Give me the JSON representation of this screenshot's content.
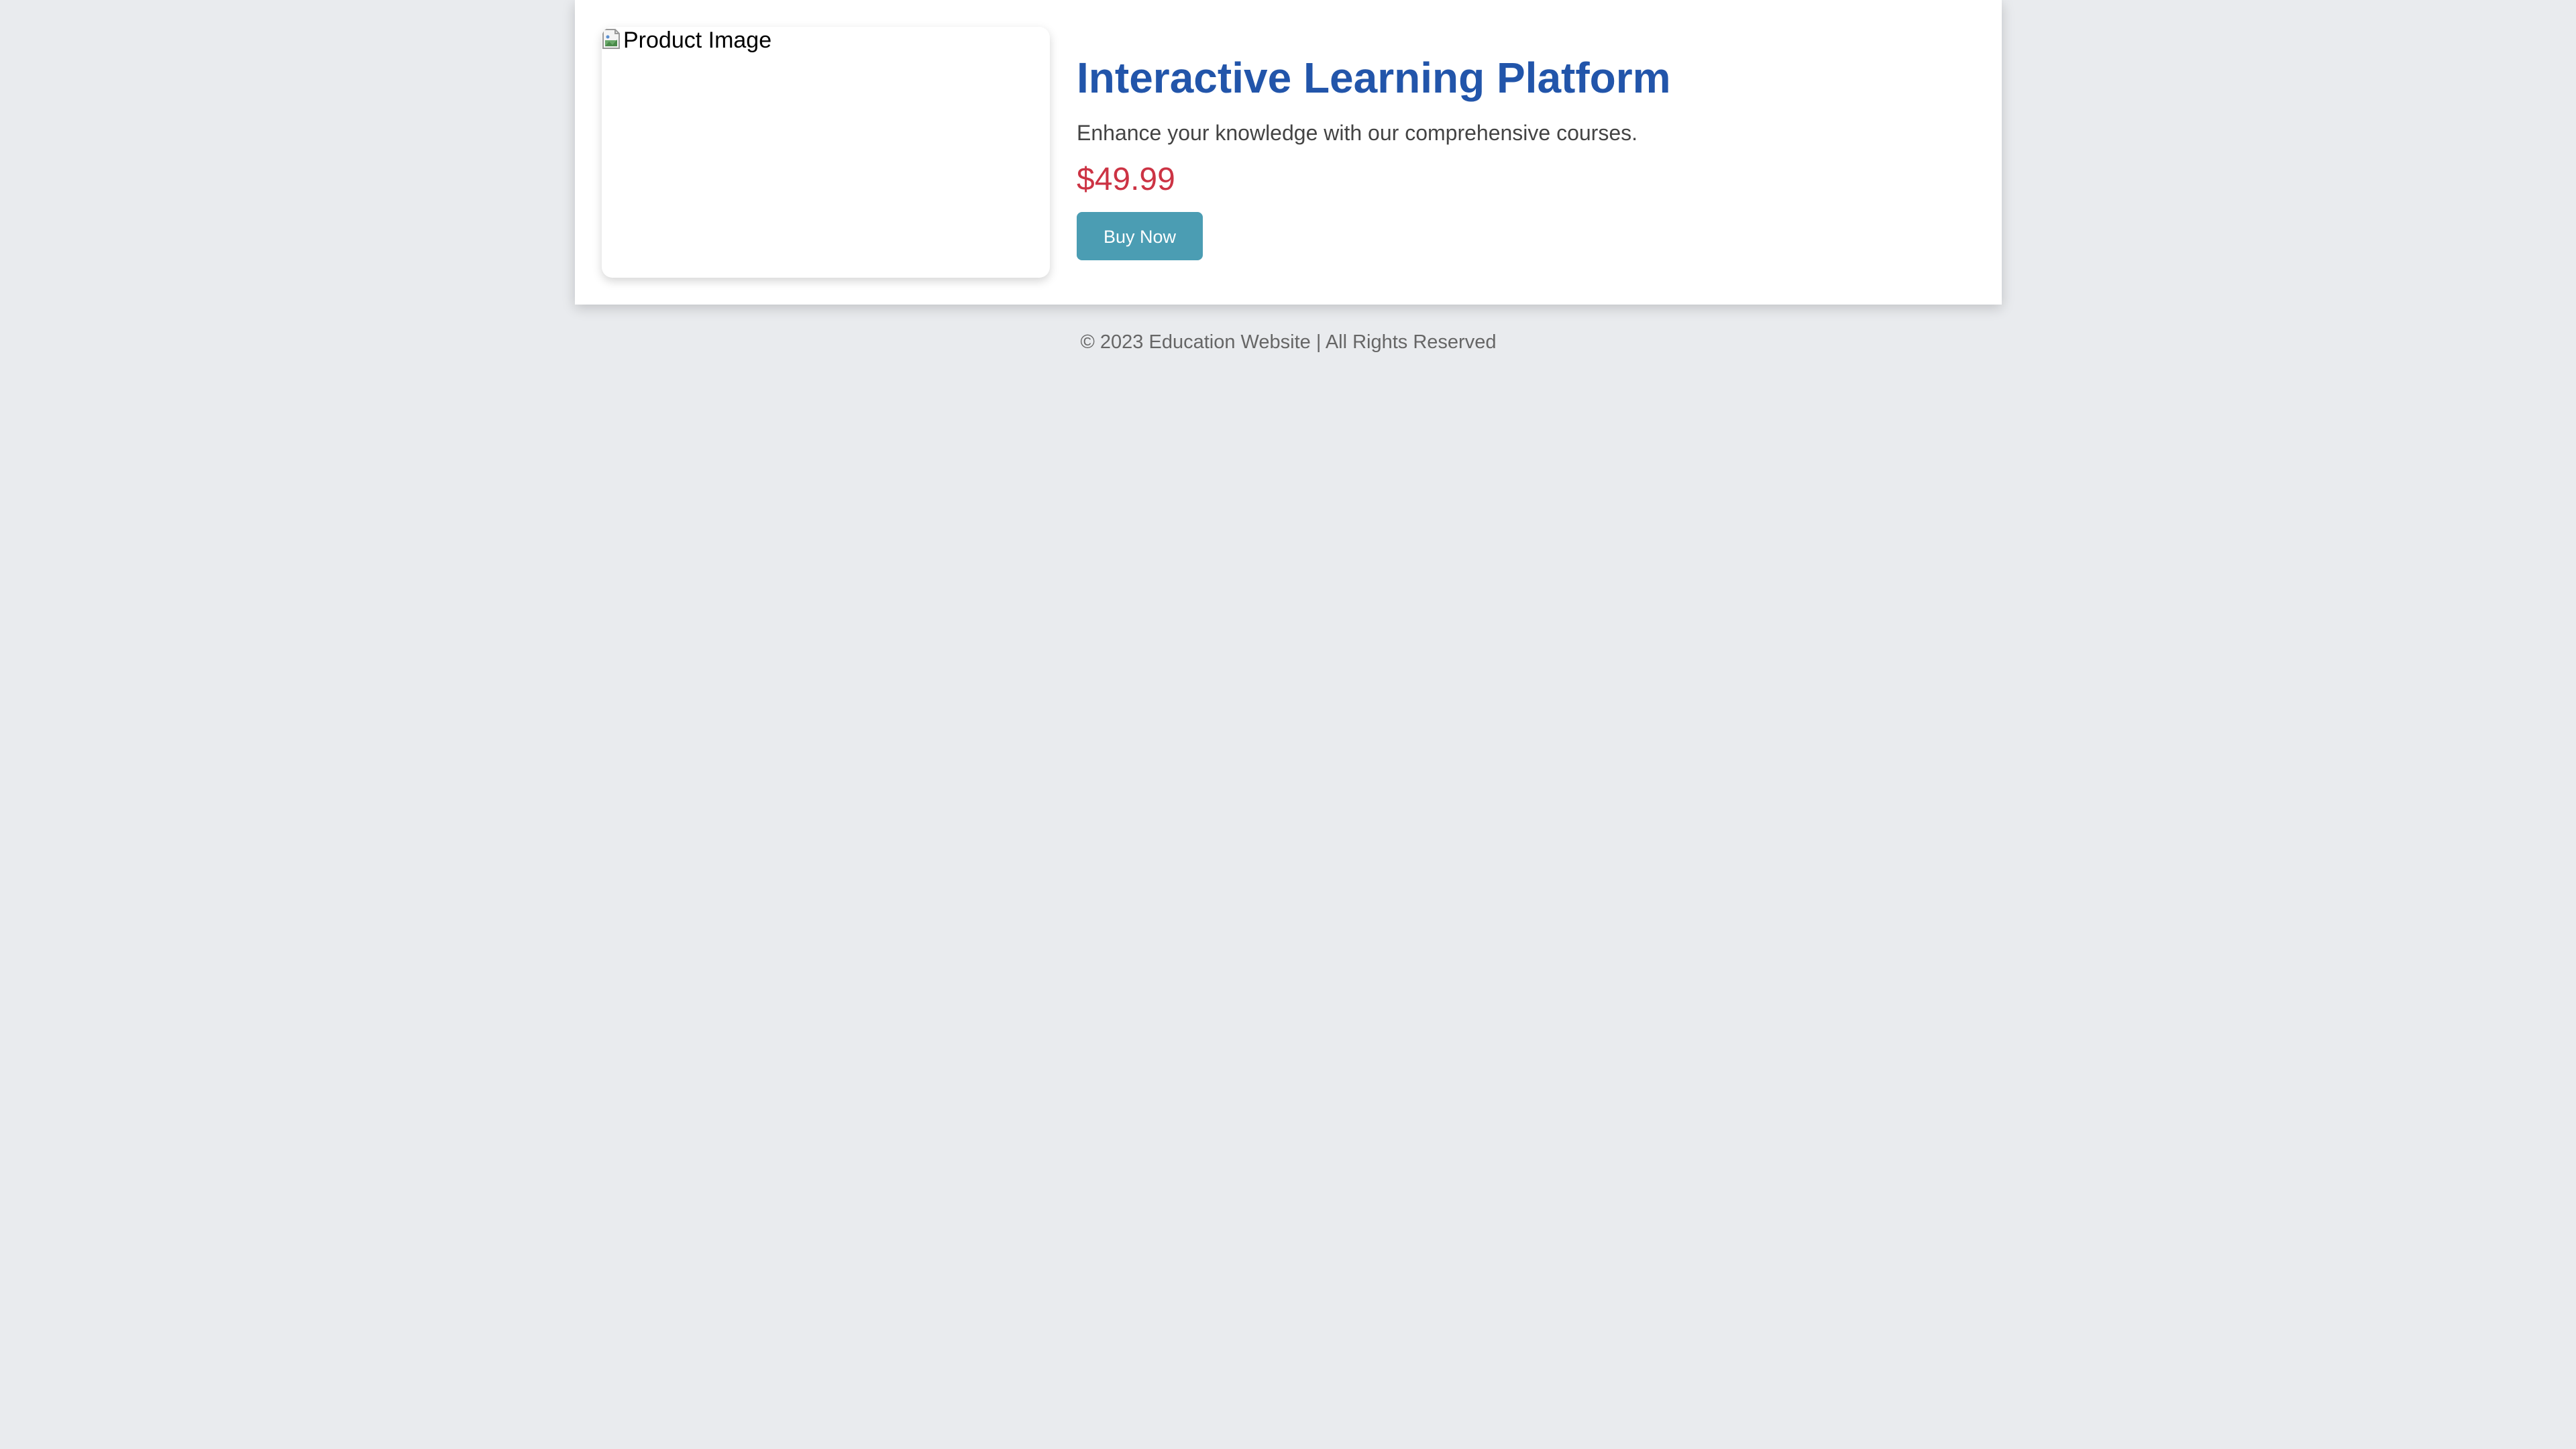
{
  "product": {
    "image_alt": "Product Image",
    "title": "Interactive Learning Platform",
    "description": "Enhance your knowledge with our comprehensive courses.",
    "price": "$49.99",
    "buy_label": "Buy Now"
  },
  "footer": {
    "text": "© 2023 Education Website | All Rights Reserved"
  },
  "colors": {
    "page_background": "#e9ebee",
    "title": "#2255aa",
    "price": "#cc3344",
    "button": "#4b9db3"
  },
  "icons": {
    "image_placeholder": "broken-image-icon"
  }
}
